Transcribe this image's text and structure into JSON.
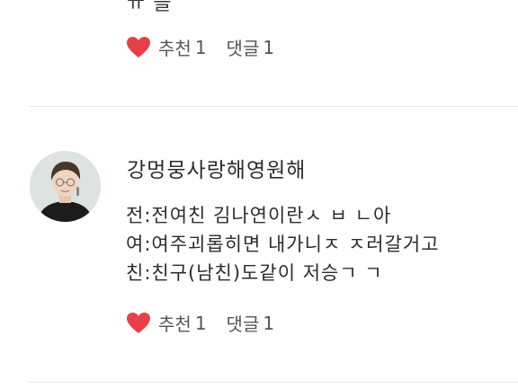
{
  "previous_comment": {
    "clipped_text": "ㅠ 을",
    "recommend_label": "추천",
    "recommend_count": "1",
    "comment_label": "댓글",
    "comment_count": "1"
  },
  "comment": {
    "author": "강멍뭉사랑해영원해",
    "lines": [
      "전:전여친 김나연이란ㅅ ㅂ ㄴ아",
      "여:여주괴롭히면 내가니ㅈ ㅈ러갈거고",
      "친:친구(남친)도같이 저승ㄱ ㄱ"
    ],
    "recommend_label": "추천",
    "recommend_count": "1",
    "comment_label": "댓글",
    "comment_count": "1"
  },
  "colors": {
    "heart": "#e8404a",
    "divider": "#e6e6e6",
    "text": "#2c2c2c"
  },
  "icons": {
    "heart": "heart-icon",
    "avatar": "profile-avatar"
  }
}
